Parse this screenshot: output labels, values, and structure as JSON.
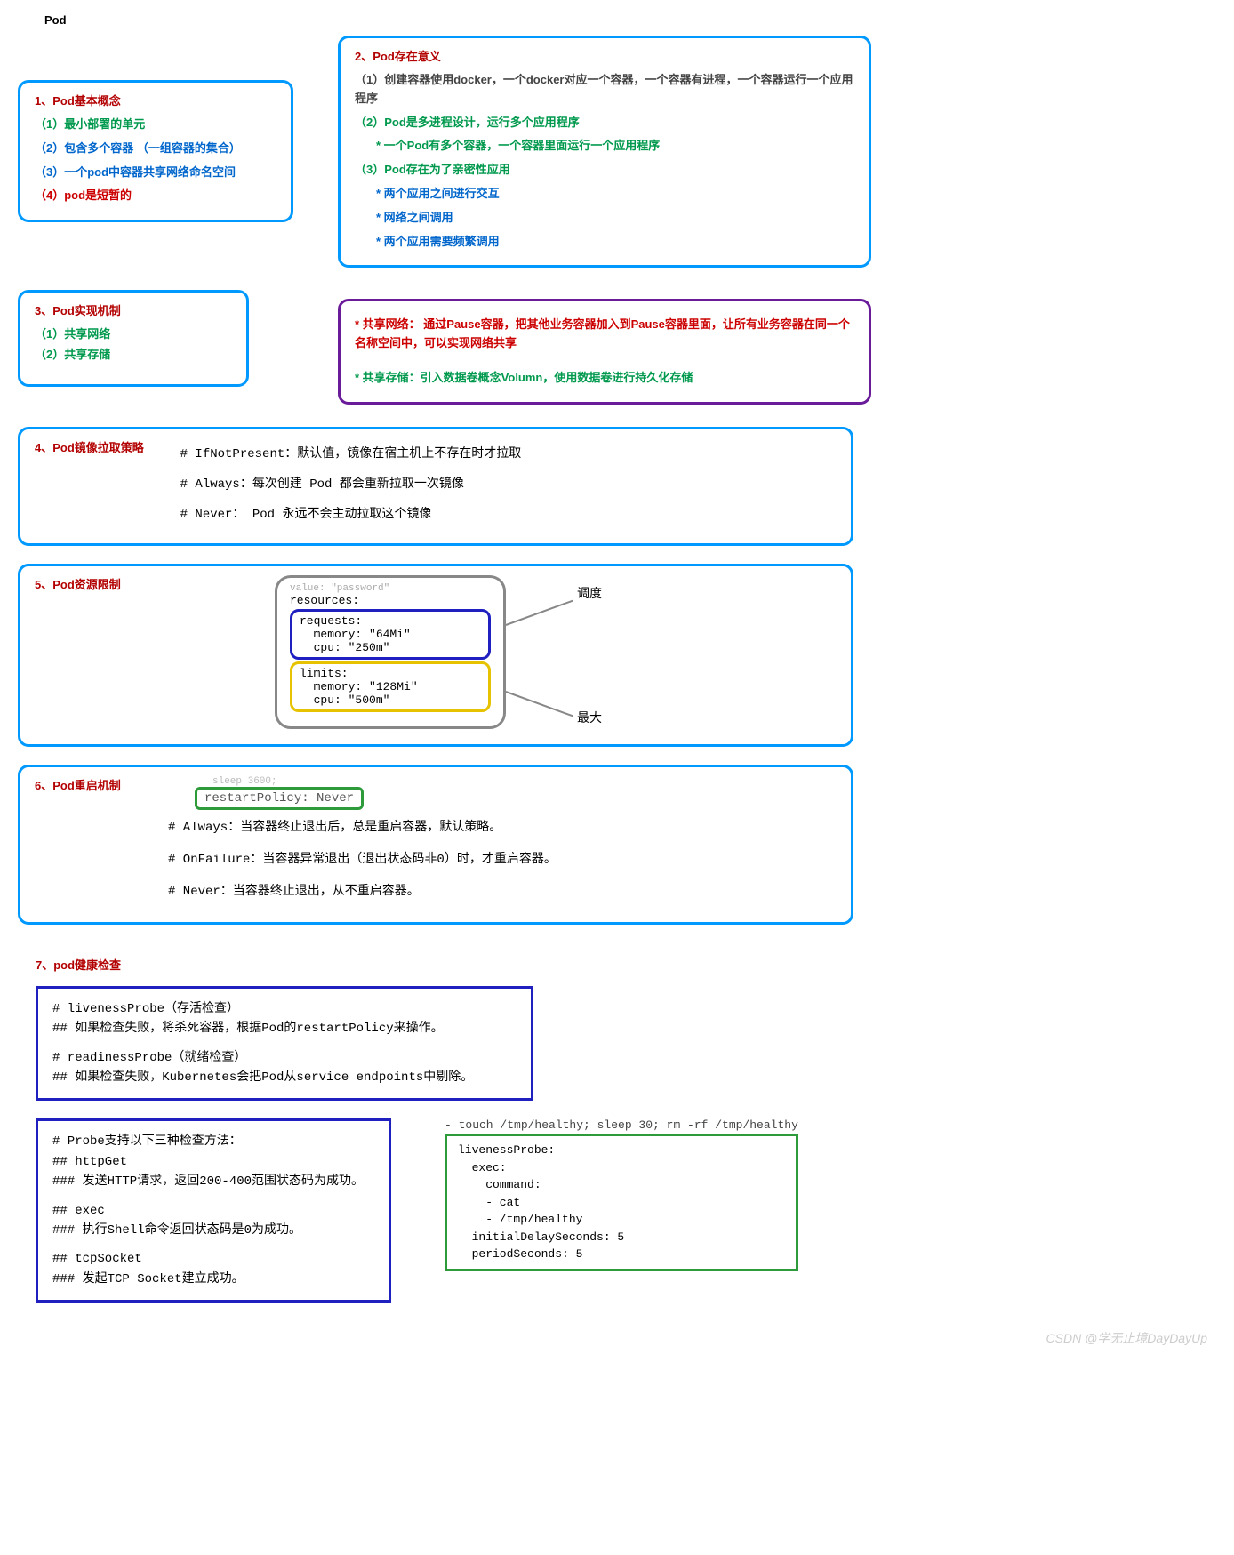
{
  "title": "Pod",
  "box1": {
    "heading": "1、Pod基本概念",
    "l1": "（1）最小部署的单元",
    "l2": "（2）包含多个容器  （一组容器的集合）",
    "l3": "（3）一个pod中容器共享网络命名空间",
    "l4": "（4）pod是短暂的"
  },
  "box2": {
    "heading": "2、Pod存在意义",
    "l1": "（1）创建容器使用docker，一个docker对应一个容器，一个容器有进程，一个容器运行一个应用程序",
    "l2": "（2）Pod是多进程设计，运行多个应用程序",
    "l2a": "* 一个Pod有多个容器，一个容器里面运行一个应用程序",
    "l3": "（3）Pod存在为了亲密性应用",
    "l3a": "* 两个应用之间进行交互",
    "l3b": "* 网络之间调用",
    "l3c": "* 两个应用需要频繁调用"
  },
  "box3": {
    "heading": "3、Pod实现机制",
    "l1": "（1）共享网络",
    "l2": "（2）共享存储"
  },
  "box3r": {
    "l1": "* 共享网络：  通过Pause容器，把其他业务容器加入到Pause容器里面，让所有业务容器在同一个名称空间中，可以实现网络共享",
    "l2": "* 共享存储：引入数据卷概念Volumn，使用数据卷进行持久化存储"
  },
  "box4": {
    "heading": "4、Pod镜像拉取策略",
    "p1": "# IfNotPresent：默认值，镜像在宿主机上不存在时才拉取",
    "p2": "# Always：每次创建 Pod 都会重新拉取一次镜像",
    "p3": "# Never： Pod 永远不会主动拉取这个镜像"
  },
  "box5": {
    "heading": "5、Pod资源限制",
    "top": "value: \"password\"",
    "res": "resources:",
    "req": "requests:",
    "req_mem": "  memory: \"64Mi\"",
    "req_cpu": "  cpu: \"250m\"",
    "lim": "limits:",
    "lim_mem": "  memory: \"128Mi\"",
    "lim_cpu": "  cpu: \"500m\"",
    "label1": "调度",
    "label2": "最大"
  },
  "box6": {
    "heading": "6、Pod重启机制",
    "top": "sleep 3600;",
    "code": "restartPolicy: Never",
    "p1": "# Always：当容器终止退出后，总是重启容器，默认策略。",
    "p2": "# OnFailure：当容器异常退出（退出状态码非0）时，才重启容器。",
    "p3": "# Never：当容器终止退出，从不重启容器。"
  },
  "sec7": {
    "heading": "7、pod健康检查",
    "box1_l1": "# livenessProbe（存活检查）",
    "box1_l2": "## 如果检查失败，将杀死容器，根据Pod的restartPolicy来操作。",
    "box1_l3": "# readinessProbe（就绪检查）",
    "box1_l4": "## 如果检查失败，Kubernetes会把Pod从service endpoints中剔除。",
    "box2_l1": "# Probe支持以下三种检查方法：",
    "box2_l2": "## httpGet",
    "box2_l3": "### 发送HTTP请求，返回200-400范围状态码为成功。",
    "box2_l4": "## exec",
    "box2_l5": "### 执行Shell命令返回状态码是0为成功。",
    "box2_l6": "## tcpSocket",
    "box2_l7": "### 发起TCP Socket建立成功。",
    "pre_yaml": "- touch /tmp/healthy; sleep 30; rm -rf /tmp/healthy",
    "yaml": "livenessProbe:\n  exec:\n    command:\n    - cat\n    - /tmp/healthy\n  initialDelaySeconds: 5\n  periodSeconds: 5"
  },
  "watermark": "CSDN @学无止境DayDayUp"
}
